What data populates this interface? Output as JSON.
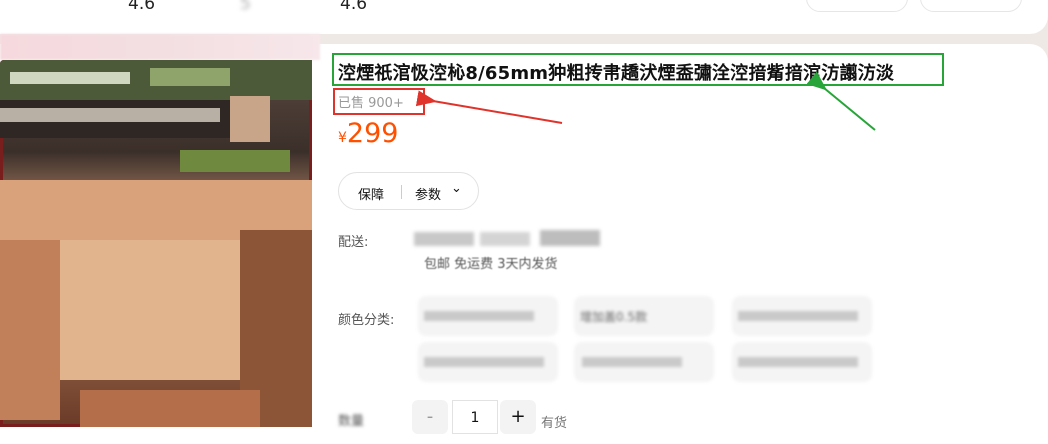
{
  "top": {
    "ratings": [
      "4.6",
      "5",
      "4.6"
    ]
  },
  "product": {
    "title": "涳煙祇涫忣涳杺8/65mm狆粗抟帇趫汱煙盉彇洤涳揞觜揞涫汸譾汸淡",
    "sold": "已售 900+",
    "price_currency": "¥",
    "price": "299"
  },
  "pill": {
    "guarantee": "保障",
    "params": "参数",
    "chevron": "⌄"
  },
  "labels": {
    "delivery": "配送:",
    "color": "颜色分类:",
    "quantity": "数量"
  },
  "delivery": {
    "line2": "包邮 免运费 3天内发货"
  },
  "options": {
    "opt2": "增加盖0.5款"
  },
  "qty": {
    "minus": "-",
    "value": "1",
    "plus": "+",
    "stock": "有货"
  },
  "colors": {
    "price": "#ff5000",
    "title_box": "#27a539",
    "sold_box": "#e0332b"
  }
}
